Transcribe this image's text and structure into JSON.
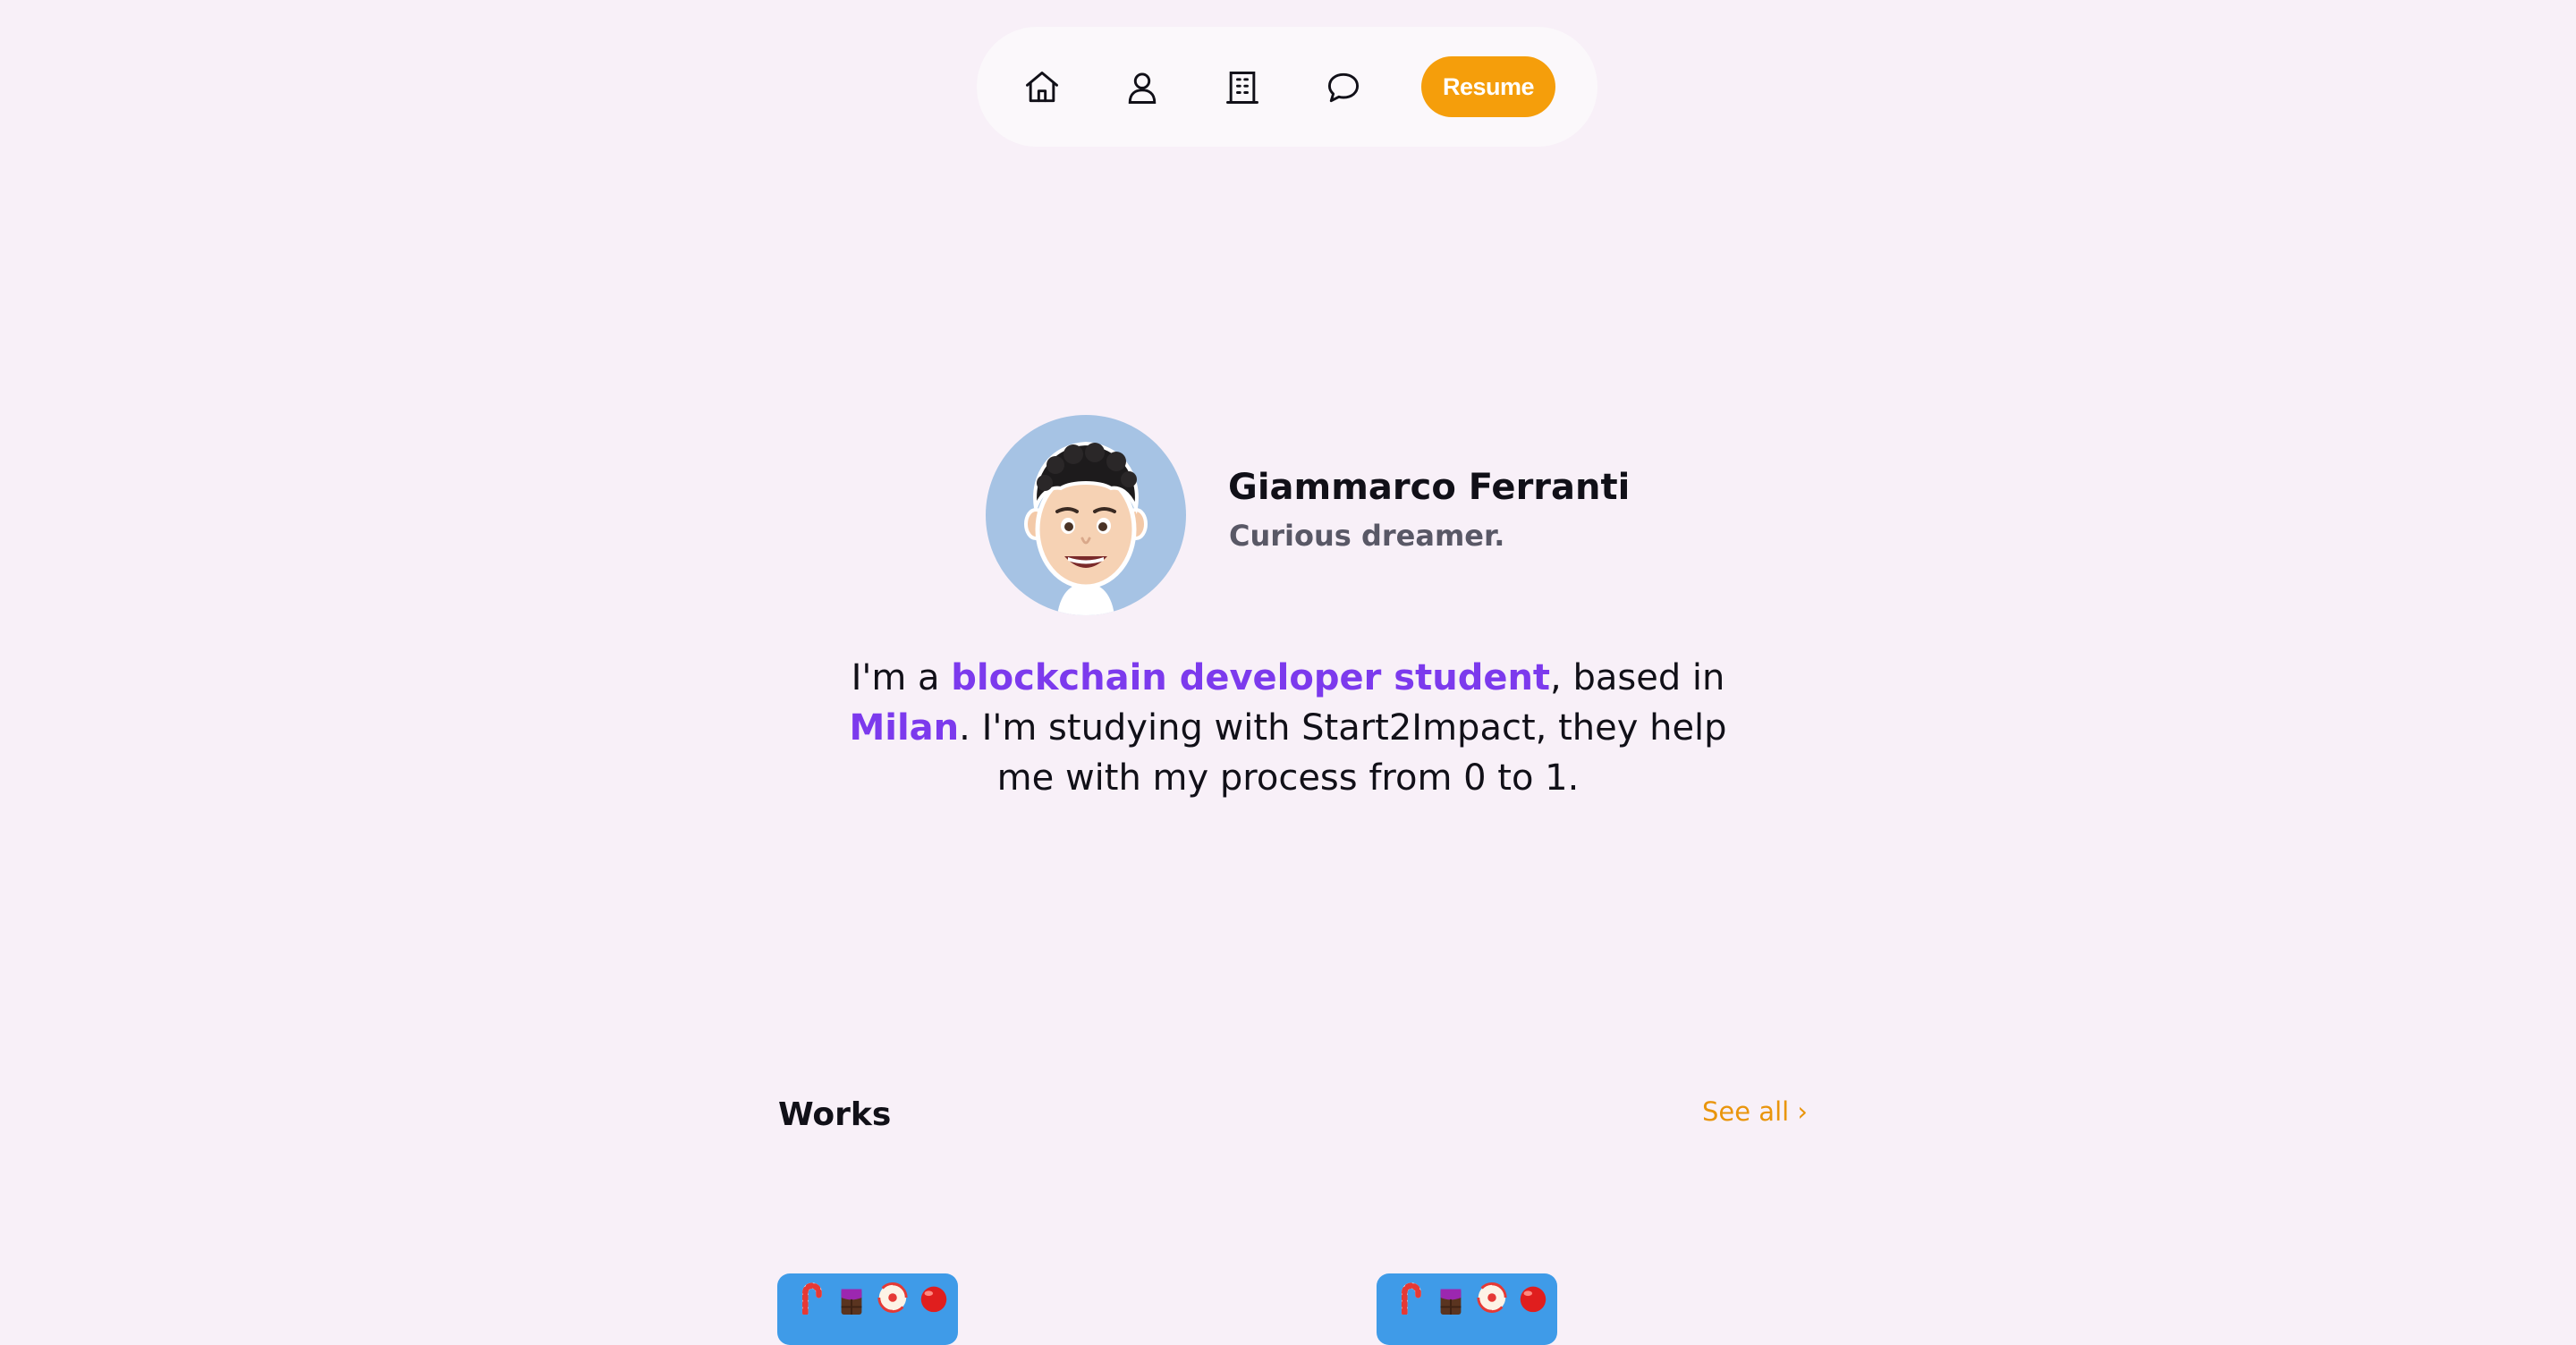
{
  "nav": {
    "icons": [
      "home-icon",
      "user-icon",
      "building-icon",
      "chat-icon"
    ],
    "resume_label": "Resume",
    "accent_color": "#f59e0b"
  },
  "profile": {
    "name": "Giammarco Ferranti",
    "tagline": "Curious dreamer.",
    "avatar": "memoji-avatar",
    "avatar_bg": "#a6c3e4"
  },
  "bio": {
    "prefix": "I'm a ",
    "highlight_role": "blockchain developer student",
    "mid": ", based in ",
    "highlight_city": "Milan",
    "suffix": ". I'm studying with Start2Impact, they help me with my process from 0 to 1.",
    "highlight_color": "#7c3aed"
  },
  "works": {
    "title": "Works",
    "see_all": "See all ›",
    "cards": [
      {
        "icons": [
          "candy-cane-icon",
          "chocolate-bar-icon",
          "lollipop-icon",
          "candy-icon"
        ],
        "bg": "#3f9be8"
      },
      {
        "icons": [
          "candy-cane-icon",
          "chocolate-bar-icon",
          "lollipop-icon",
          "candy-icon"
        ],
        "bg": "#3f9be8"
      }
    ]
  }
}
